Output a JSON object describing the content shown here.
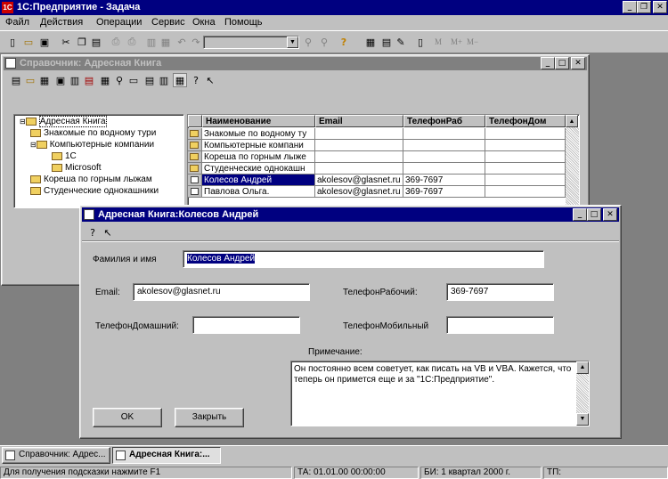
{
  "app": {
    "title": "1С:Предприятие - Задача"
  },
  "menu": [
    "Файл",
    "Действия",
    "Операции",
    "Сервис",
    "Окна",
    "Помощь"
  ],
  "toolbar": {
    "zoom_labels": [
      "M",
      "M+",
      "M−"
    ]
  },
  "directory": {
    "title": "Справочник: Адресная Книга",
    "tree": {
      "root": "Адресная Книга",
      "items": [
        "Знакомые по водному тури",
        "Компьютерные компании",
        "1С",
        "Microsoft",
        "Кореша по горным лыжам",
        "Студенческие однокашники"
      ]
    },
    "columns": [
      "Наименование",
      "Email",
      "ТелефонРаб",
      "ТелефонДом"
    ],
    "rows": [
      {
        "name": "Знакомые по водному ту",
        "email": "",
        "work": "",
        "home": "",
        "folder": true
      },
      {
        "name": "Компьютерные компани",
        "email": "",
        "work": "",
        "home": "",
        "folder": true
      },
      {
        "name": "Кореша по горным лыже",
        "email": "",
        "work": "",
        "home": "",
        "folder": true
      },
      {
        "name": "Студенческие однокашн",
        "email": "",
        "work": "",
        "home": "",
        "folder": true
      },
      {
        "name": "Колесов Андрей",
        "email": "akolesov@glasnet.ru",
        "work": "369-7697",
        "home": "",
        "folder": false,
        "selected": true
      },
      {
        "name": "Павлова Ольга.",
        "email": "akolesov@glasnet.ru",
        "work": "369-7697",
        "home": "",
        "folder": false
      }
    ]
  },
  "form": {
    "title": "Адресная Книга:Колесов Андрей",
    "fio_label": "Фамилия и имя",
    "fio_value": "Колесов Андрей",
    "email_label": "Email:",
    "email_value": "akolesov@glasnet.ru",
    "work_phone_label": "ТелефонРабочий:",
    "work_phone_value": "369-7697",
    "home_phone_label": "ТелефонДомашний:",
    "home_phone_value": "",
    "mobile_label": "ТелефонМобильный",
    "mobile_value": "",
    "note_label": "Примечание:",
    "note_value": "Он постоянно всем советует, как писать на VB и VBA. Кажется, что теперь он примется еще и за \"1С:Предприятие\".",
    "ok_label": "OK",
    "close_label": "Закрыть"
  },
  "taskbar": [
    "Справочник: Адрес...",
    "Адресная Книга:..."
  ],
  "status": {
    "hint": "Для получения подсказки нажмите F1",
    "ta": "ТА: 01.01.00  00:00:00",
    "bi": "БИ: 1 квартал 2000 г.",
    "tp": "ТП:"
  }
}
